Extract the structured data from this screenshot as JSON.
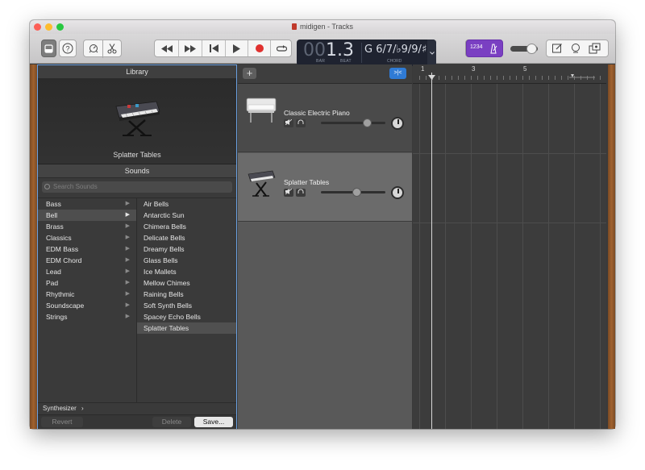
{
  "window": {
    "title": "midigen - Tracks"
  },
  "toolbar": {
    "buttons": [
      "library-button",
      "help-button",
      "smart-controls-button",
      "editors-button"
    ],
    "transport": [
      "rewind",
      "fast-forward",
      "go-to-beginning",
      "play",
      "record",
      "cycle"
    ],
    "lcd": {
      "bar_dim": "00",
      "bar_value": "1.3",
      "bar_label": "BAR",
      "beat_label": "BEAT",
      "chord": "G 6/7/♭9/9/♯9/",
      "chord_label": "CHORD"
    },
    "count_in": "1234",
    "colors": {
      "count_in_bg": "#7a3fc2",
      "record": "#e0312f"
    }
  },
  "library": {
    "header": "Library",
    "selected_patch": "Splatter Tables",
    "sounds_header": "Sounds",
    "search_placeholder": "Search Sounds",
    "categories": [
      {
        "label": "Bass",
        "selected": false
      },
      {
        "label": "Bell",
        "selected": true
      },
      {
        "label": "Brass",
        "selected": false
      },
      {
        "label": "Classics",
        "selected": false
      },
      {
        "label": "EDM Bass",
        "selected": false
      },
      {
        "label": "EDM Chord",
        "selected": false
      },
      {
        "label": "Lead",
        "selected": false
      },
      {
        "label": "Pad",
        "selected": false
      },
      {
        "label": "Rhythmic",
        "selected": false
      },
      {
        "label": "Soundscape",
        "selected": false
      },
      {
        "label": "Strings",
        "selected": false
      }
    ],
    "patches": [
      {
        "label": "Air Bells",
        "selected": false
      },
      {
        "label": "Antarctic Sun",
        "selected": false
      },
      {
        "label": "Chimera Bells",
        "selected": false
      },
      {
        "label": "Delicate Bells",
        "selected": false
      },
      {
        "label": "Dreamy Bells",
        "selected": false
      },
      {
        "label": "Glass Bells",
        "selected": false
      },
      {
        "label": "Ice Mallets",
        "selected": false
      },
      {
        "label": "Mellow Chimes",
        "selected": false
      },
      {
        "label": "Raining Bells",
        "selected": false
      },
      {
        "label": "Soft Synth Bells",
        "selected": false
      },
      {
        "label": "Spacey Echo Bells",
        "selected": false
      },
      {
        "label": "Splatter Tables",
        "selected": true
      }
    ],
    "synthesizer_label": "Synthesizer",
    "footer": {
      "revert": "Revert",
      "delete": "Delete",
      "save": "Save..."
    }
  },
  "tracks": [
    {
      "name": "Classic Electric Piano",
      "volume": 0.72,
      "selected": false
    },
    {
      "name": "Splatter Tables",
      "volume": 0.55,
      "selected": true
    }
  ],
  "timeline": {
    "bar_numbers": [
      "1",
      "3",
      "5"
    ]
  }
}
